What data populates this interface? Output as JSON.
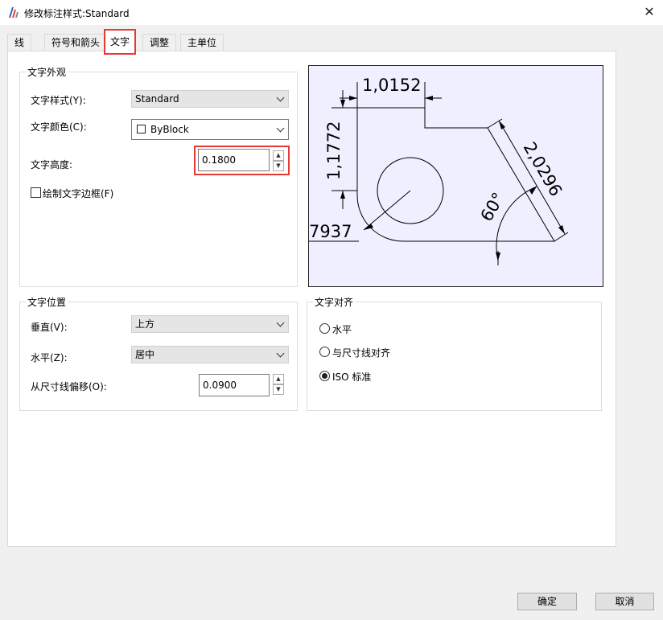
{
  "window": {
    "title": "修改标注样式:Standard"
  },
  "tabs": [
    {
      "label": "线"
    },
    {
      "label": "符号和箭头"
    },
    {
      "label": "文字"
    },
    {
      "label": "调整"
    },
    {
      "label": "主单位"
    }
  ],
  "text_appearance": {
    "group_label": "文字外观",
    "style_label": "文字样式(Y):",
    "style_value": "Standard",
    "color_label": "文字颜色(C):",
    "color_value": "ByBlock",
    "height_label": "文字高度:",
    "height_value": "0.1800",
    "frame_label": "绘制文字边框(F)"
  },
  "text_position": {
    "group_label": "文字位置",
    "vertical_label": "垂直(V):",
    "vertical_value": "上方",
    "horizontal_label": "水平(Z):",
    "horizontal_value": "居中",
    "offset_label": "从尺寸线偏移(O):",
    "offset_value": "0.0900"
  },
  "text_alignment": {
    "group_label": "文字对齐",
    "options": [
      {
        "label": "水平",
        "checked": false
      },
      {
        "label": "与尺寸线对齐",
        "checked": false
      },
      {
        "label": "ISO 标准",
        "checked": true
      }
    ]
  },
  "preview": {
    "dim_top": "1,0152",
    "dim_left": "1,1772",
    "dim_diag": "2,0296",
    "dim_angle": "60°",
    "dim_radius": "7937"
  },
  "footer": {
    "ok_label": "确定",
    "cancel_label": "取消"
  },
  "colors": {
    "highlight": "#e53935",
    "preview_bg": "#f0efff"
  }
}
